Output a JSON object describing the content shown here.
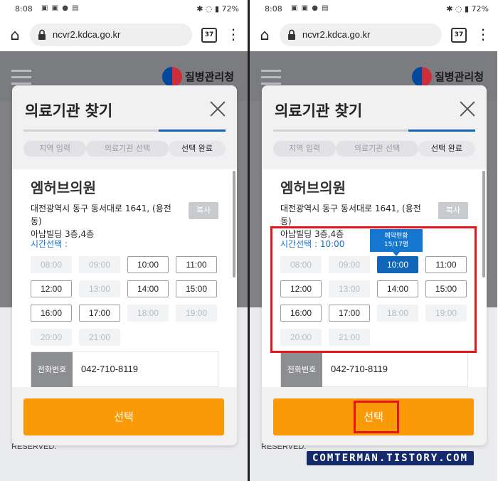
{
  "status_bar": {
    "time": "8:08",
    "battery": "72%"
  },
  "browser": {
    "url": "ncvr2.kdca.go.kr",
    "tab_count": "37"
  },
  "site": {
    "logo_text": "질병관리청",
    "footer_text": "RESERVED."
  },
  "modal": {
    "title": "의료기관 찾기",
    "steps": [
      "지역 입력",
      "의료기관 선택",
      "선택 완료"
    ],
    "clinic_name": "엠허브의원",
    "address_line1": "대전광역시 동구 동서대로 1641, (용전동)",
    "address_line2": "아남빌딩 3층,4층",
    "copy_label": "복사",
    "phone_label": "전화번호",
    "phone_value": "042-710-8119",
    "select_label": "선택"
  },
  "screens": [
    {
      "time_label": "시간선택 :",
      "slots": [
        {
          "t": "08:00",
          "state": "disabled"
        },
        {
          "t": "09:00",
          "state": "disabled"
        },
        {
          "t": "10:00",
          "state": "enabled"
        },
        {
          "t": "11:00",
          "state": "enabled"
        },
        {
          "t": "12:00",
          "state": "enabled"
        },
        {
          "t": "13:00",
          "state": "disabled"
        },
        {
          "t": "14:00",
          "state": "enabled"
        },
        {
          "t": "15:00",
          "state": "enabled"
        },
        {
          "t": "16:00",
          "state": "enabled"
        },
        {
          "t": "17:00",
          "state": "enabled"
        },
        {
          "t": "18:00",
          "state": "disabled"
        },
        {
          "t": "19:00",
          "state": "disabled"
        },
        {
          "t": "20:00",
          "state": "disabled"
        },
        {
          "t": "21:00",
          "state": "disabled"
        }
      ]
    },
    {
      "time_label": "시간선택 : 10:00",
      "tooltip_title": "예약현황",
      "tooltip_value": "15/17명",
      "slots": [
        {
          "t": "08:00",
          "state": "disabled"
        },
        {
          "t": "09:00",
          "state": "disabled"
        },
        {
          "t": "10:00",
          "state": "selected"
        },
        {
          "t": "11:00",
          "state": "enabled"
        },
        {
          "t": "12:00",
          "state": "enabled"
        },
        {
          "t": "13:00",
          "state": "disabled"
        },
        {
          "t": "14:00",
          "state": "enabled"
        },
        {
          "t": "15:00",
          "state": "enabled"
        },
        {
          "t": "16:00",
          "state": "enabled"
        },
        {
          "t": "17:00",
          "state": "enabled"
        },
        {
          "t": "18:00",
          "state": "disabled"
        },
        {
          "t": "19:00",
          "state": "disabled"
        },
        {
          "t": "20:00",
          "state": "disabled"
        },
        {
          "t": "21:00",
          "state": "disabled"
        }
      ]
    }
  ],
  "colors": {
    "accent_blue": "#0f66b8",
    "select_orange": "#fb9a09",
    "highlight_red": "#e8141c",
    "watermark_bg": "#142a6b"
  },
  "watermark": "COMTERMAN.TISTORY.COM"
}
